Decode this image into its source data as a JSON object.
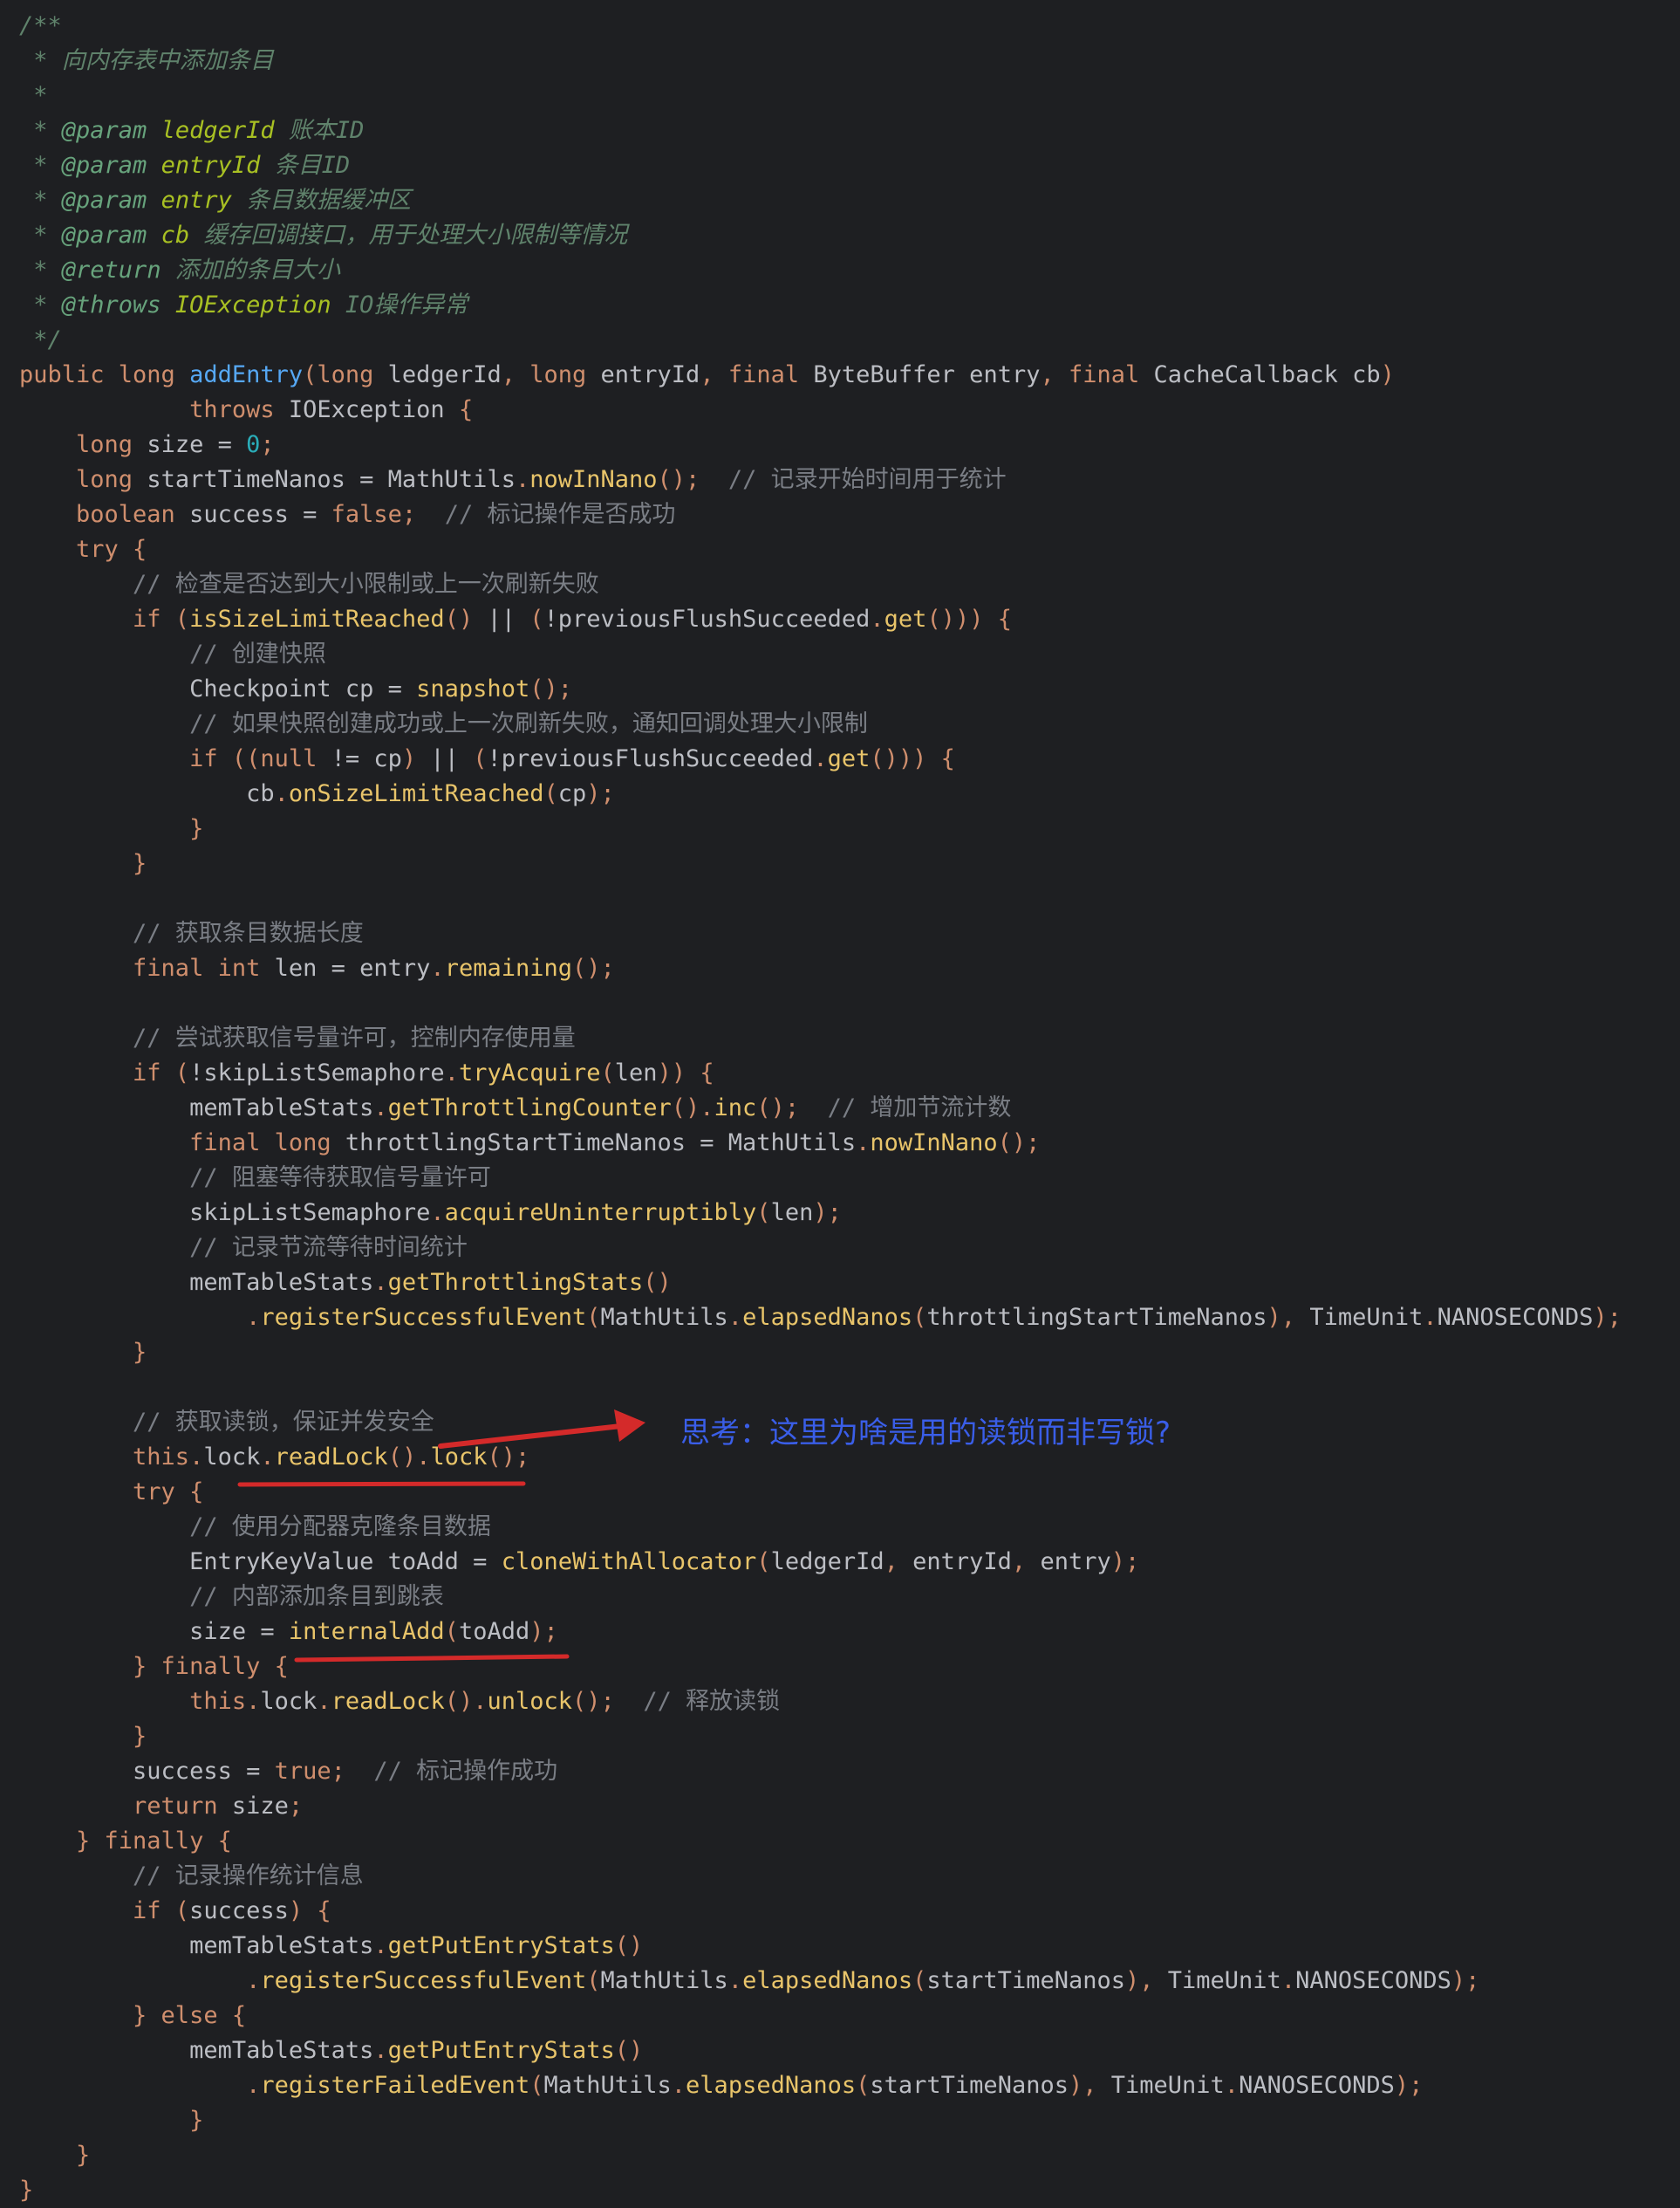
{
  "code_lines": [
    [
      {
        "t": "/**",
        "c": "doc"
      }
    ],
    [
      {
        "t": " * 向内存表中添加条目",
        "c": "doc"
      }
    ],
    [
      {
        "t": " *",
        "c": "doc"
      }
    ],
    [
      {
        "t": " * ",
        "c": "doc"
      },
      {
        "t": "@param",
        "c": "doctag"
      },
      {
        "t": " ledgerId",
        "c": "docparam"
      },
      {
        "t": " 账本ID",
        "c": "doc"
      }
    ],
    [
      {
        "t": " * ",
        "c": "doc"
      },
      {
        "t": "@param",
        "c": "doctag"
      },
      {
        "t": " entryId",
        "c": "docparam"
      },
      {
        "t": " 条目ID",
        "c": "doc"
      }
    ],
    [
      {
        "t": " * ",
        "c": "doc"
      },
      {
        "t": "@param",
        "c": "doctag"
      },
      {
        "t": " entry",
        "c": "docparam"
      },
      {
        "t": " 条目数据缓冲区",
        "c": "doc"
      }
    ],
    [
      {
        "t": " * ",
        "c": "doc"
      },
      {
        "t": "@param",
        "c": "doctag"
      },
      {
        "t": " cb",
        "c": "docparam"
      },
      {
        "t": " 缓存回调接口，用于处理大小限制等情况",
        "c": "doc"
      }
    ],
    [
      {
        "t": " * ",
        "c": "doc"
      },
      {
        "t": "@return",
        "c": "doctag"
      },
      {
        "t": " 添加的条目大小",
        "c": "doc"
      }
    ],
    [
      {
        "t": " * ",
        "c": "doc"
      },
      {
        "t": "@throws",
        "c": "doctag"
      },
      {
        "t": " IOException",
        "c": "docparam"
      },
      {
        "t": " IO操作异常",
        "c": "doc"
      }
    ],
    [
      {
        "t": " */",
        "c": "doc"
      }
    ],
    [
      {
        "t": "public long ",
        "c": "kw"
      },
      {
        "t": "addEntry",
        "c": "fn"
      },
      {
        "t": "(",
        "c": "kw"
      },
      {
        "t": "long ",
        "c": "kw"
      },
      {
        "t": "ledgerId",
        "c": "punct"
      },
      {
        "t": ", ",
        "c": "kw"
      },
      {
        "t": "long ",
        "c": "kw"
      },
      {
        "t": "entryId",
        "c": "punct"
      },
      {
        "t": ", ",
        "c": "kw"
      },
      {
        "t": "final ",
        "c": "kw"
      },
      {
        "t": "ByteBuffer entry",
        "c": "punct"
      },
      {
        "t": ", ",
        "c": "kw"
      },
      {
        "t": "final ",
        "c": "kw"
      },
      {
        "t": "CacheCallback cb",
        "c": "punct"
      },
      {
        "t": ")",
        "c": "kw"
      }
    ],
    [
      {
        "t": "            throws ",
        "c": "kw"
      },
      {
        "t": "IOException ",
        "c": "punct"
      },
      {
        "t": "{",
        "c": "kw"
      }
    ],
    [
      {
        "t": "    long ",
        "c": "kw"
      },
      {
        "t": "size = ",
        "c": "punct"
      },
      {
        "t": "0",
        "c": "num"
      },
      {
        "t": ";",
        "c": "kw"
      }
    ],
    [
      {
        "t": "    long ",
        "c": "kw"
      },
      {
        "t": "startTimeNanos = MathUtils",
        "c": "punct"
      },
      {
        "t": ".",
        "c": "kw"
      },
      {
        "t": "nowInNano",
        "c": "mc"
      },
      {
        "t": "();",
        "c": "kw"
      },
      {
        "t": "  // 记录开始时间用于统计",
        "c": "cm"
      }
    ],
    [
      {
        "t": "    boolean ",
        "c": "kw"
      },
      {
        "t": "success = ",
        "c": "punct"
      },
      {
        "t": "false;",
        "c": "kw"
      },
      {
        "t": "  // 标记操作是否成功",
        "c": "cm"
      }
    ],
    [
      {
        "t": "    try {",
        "c": "kw"
      }
    ],
    [
      {
        "t": "        // 检查是否达到大小限制或上一次刷新失败",
        "c": "cm"
      }
    ],
    [
      {
        "t": "        if (",
        "c": "kw"
      },
      {
        "t": "isSizeLimitReached",
        "c": "mc"
      },
      {
        "t": "() ",
        "c": "kw"
      },
      {
        "t": "|| ",
        "c": "punct"
      },
      {
        "t": "(",
        "c": "kw"
      },
      {
        "t": "!previousFlushSucceeded",
        "c": "punct"
      },
      {
        "t": ".",
        "c": "kw"
      },
      {
        "t": "get",
        "c": "mc"
      },
      {
        "t": "())) {",
        "c": "kw"
      }
    ],
    [
      {
        "t": "            // 创建快照",
        "c": "cm"
      }
    ],
    [
      {
        "t": "            Checkpoint cp = ",
        "c": "punct"
      },
      {
        "t": "snapshot",
        "c": "mc"
      },
      {
        "t": "();",
        "c": "kw"
      }
    ],
    [
      {
        "t": "            // 如果快照创建成功或上一次刷新失败，通知回调处理大小限制",
        "c": "cm"
      }
    ],
    [
      {
        "t": "            if ((null ",
        "c": "kw"
      },
      {
        "t": "!= cp",
        "c": "punct"
      },
      {
        "t": ") ",
        "c": "kw"
      },
      {
        "t": "|| ",
        "c": "punct"
      },
      {
        "t": "(",
        "c": "kw"
      },
      {
        "t": "!previousFlushSucceeded",
        "c": "punct"
      },
      {
        "t": ".",
        "c": "kw"
      },
      {
        "t": "get",
        "c": "mc"
      },
      {
        "t": "())) {",
        "c": "kw"
      }
    ],
    [
      {
        "t": "                cb",
        "c": "punct"
      },
      {
        "t": ".",
        "c": "kw"
      },
      {
        "t": "onSizeLimitReached",
        "c": "mc"
      },
      {
        "t": "(",
        "c": "kw"
      },
      {
        "t": "cp",
        "c": "punct"
      },
      {
        "t": ");",
        "c": "kw"
      }
    ],
    [
      {
        "t": "            }",
        "c": "kw"
      }
    ],
    [
      {
        "t": "        }",
        "c": "kw"
      }
    ],
    [],
    [
      {
        "t": "        // 获取条目数据长度",
        "c": "cm"
      }
    ],
    [
      {
        "t": "        final int ",
        "c": "kw"
      },
      {
        "t": "len = entry",
        "c": "punct"
      },
      {
        "t": ".",
        "c": "kw"
      },
      {
        "t": "remaining",
        "c": "mc"
      },
      {
        "t": "();",
        "c": "kw"
      }
    ],
    [],
    [
      {
        "t": "        // 尝试获取信号量许可，控制内存使用量",
        "c": "cm"
      }
    ],
    [
      {
        "t": "        if (",
        "c": "kw"
      },
      {
        "t": "!skipListSemaphore",
        "c": "punct"
      },
      {
        "t": ".",
        "c": "kw"
      },
      {
        "t": "tryAcquire",
        "c": "mc"
      },
      {
        "t": "(",
        "c": "kw"
      },
      {
        "t": "len",
        "c": "punct"
      },
      {
        "t": ")) {",
        "c": "kw"
      }
    ],
    [
      {
        "t": "            memTableStats",
        "c": "punct"
      },
      {
        "t": ".",
        "c": "kw"
      },
      {
        "t": "getThrottlingCounter",
        "c": "mc"
      },
      {
        "t": "().",
        "c": "kw"
      },
      {
        "t": "inc",
        "c": "mc"
      },
      {
        "t": "();",
        "c": "kw"
      },
      {
        "t": "  // 增加节流计数",
        "c": "cm"
      }
    ],
    [
      {
        "t": "            final long ",
        "c": "kw"
      },
      {
        "t": "throttlingStartTimeNanos = MathUtils",
        "c": "punct"
      },
      {
        "t": ".",
        "c": "kw"
      },
      {
        "t": "nowInNano",
        "c": "mc"
      },
      {
        "t": "();",
        "c": "kw"
      }
    ],
    [
      {
        "t": "            // 阻塞等待获取信号量许可",
        "c": "cm"
      }
    ],
    [
      {
        "t": "            skipListSemaphore",
        "c": "punct"
      },
      {
        "t": ".",
        "c": "kw"
      },
      {
        "t": "acquireUninterruptibly",
        "c": "mc"
      },
      {
        "t": "(",
        "c": "kw"
      },
      {
        "t": "len",
        "c": "punct"
      },
      {
        "t": ");",
        "c": "kw"
      }
    ],
    [
      {
        "t": "            // 记录节流等待时间统计",
        "c": "cm"
      }
    ],
    [
      {
        "t": "            memTableStats",
        "c": "punct"
      },
      {
        "t": ".",
        "c": "kw"
      },
      {
        "t": "getThrottlingStats",
        "c": "mc"
      },
      {
        "t": "()",
        "c": "kw"
      }
    ],
    [
      {
        "t": "                .",
        "c": "kw"
      },
      {
        "t": "registerSuccessfulEvent",
        "c": "mc"
      },
      {
        "t": "(",
        "c": "kw"
      },
      {
        "t": "MathUtils",
        "c": "punct"
      },
      {
        "t": ".",
        "c": "kw"
      },
      {
        "t": "elapsedNanos",
        "c": "mc"
      },
      {
        "t": "(",
        "c": "kw"
      },
      {
        "t": "throttlingStartTimeNanos",
        "c": "punct"
      },
      {
        "t": "), ",
        "c": "kw"
      },
      {
        "t": "TimeUnit",
        "c": "punct"
      },
      {
        "t": ".",
        "c": "kw"
      },
      {
        "t": "NANOSECONDS",
        "c": "punct"
      },
      {
        "t": ");",
        "c": "kw"
      }
    ],
    [
      {
        "t": "        }",
        "c": "kw"
      }
    ],
    [],
    [
      {
        "t": "        // 获取读锁，保证并发安全",
        "c": "cm"
      }
    ],
    [
      {
        "t": "        this",
        "c": "kw"
      },
      {
        "t": ".",
        "c": "kw"
      },
      {
        "t": "lock",
        "c": "punct"
      },
      {
        "t": ".",
        "c": "kw"
      },
      {
        "t": "readLock",
        "c": "mc"
      },
      {
        "t": "().",
        "c": "kw"
      },
      {
        "t": "lock",
        "c": "mc"
      },
      {
        "t": "();",
        "c": "kw"
      }
    ],
    [
      {
        "t": "        try {",
        "c": "kw"
      }
    ],
    [
      {
        "t": "            // 使用分配器克隆条目数据",
        "c": "cm"
      }
    ],
    [
      {
        "t": "            EntryKeyValue toAdd = ",
        "c": "punct"
      },
      {
        "t": "cloneWithAllocator",
        "c": "mc"
      },
      {
        "t": "(",
        "c": "kw"
      },
      {
        "t": "ledgerId",
        "c": "punct"
      },
      {
        "t": ", ",
        "c": "kw"
      },
      {
        "t": "entryId",
        "c": "punct"
      },
      {
        "t": ", ",
        "c": "kw"
      },
      {
        "t": "entry",
        "c": "punct"
      },
      {
        "t": ");",
        "c": "kw"
      }
    ],
    [
      {
        "t": "            // 内部添加条目到跳表",
        "c": "cm"
      }
    ],
    [
      {
        "t": "            size = ",
        "c": "punct"
      },
      {
        "t": "internalAdd",
        "c": "mc"
      },
      {
        "t": "(",
        "c": "kw"
      },
      {
        "t": "toAdd",
        "c": "punct"
      },
      {
        "t": ");",
        "c": "kw"
      }
    ],
    [
      {
        "t": "        } finally {",
        "c": "kw"
      }
    ],
    [
      {
        "t": "            this",
        "c": "kw"
      },
      {
        "t": ".",
        "c": "kw"
      },
      {
        "t": "lock",
        "c": "punct"
      },
      {
        "t": ".",
        "c": "kw"
      },
      {
        "t": "readLock",
        "c": "mc"
      },
      {
        "t": "().",
        "c": "kw"
      },
      {
        "t": "unlock",
        "c": "mc"
      },
      {
        "t": "();",
        "c": "kw"
      },
      {
        "t": "  // 释放读锁",
        "c": "cm"
      }
    ],
    [
      {
        "t": "        }",
        "c": "kw"
      }
    ],
    [
      {
        "t": "        success = ",
        "c": "punct"
      },
      {
        "t": "true;",
        "c": "kw"
      },
      {
        "t": "  // 标记操作成功",
        "c": "cm"
      }
    ],
    [
      {
        "t": "        return ",
        "c": "kw"
      },
      {
        "t": "size",
        "c": "punct"
      },
      {
        "t": ";",
        "c": "kw"
      }
    ],
    [
      {
        "t": "    } finally {",
        "c": "kw"
      }
    ],
    [
      {
        "t": "        // 记录操作统计信息",
        "c": "cm"
      }
    ],
    [
      {
        "t": "        if (",
        "c": "kw"
      },
      {
        "t": "success",
        "c": "punct"
      },
      {
        "t": ") {",
        "c": "kw"
      }
    ],
    [
      {
        "t": "            memTableStats",
        "c": "punct"
      },
      {
        "t": ".",
        "c": "kw"
      },
      {
        "t": "getPutEntryStats",
        "c": "mc"
      },
      {
        "t": "()",
        "c": "kw"
      }
    ],
    [
      {
        "t": "                .",
        "c": "kw"
      },
      {
        "t": "registerSuccessfulEvent",
        "c": "mc"
      },
      {
        "t": "(",
        "c": "kw"
      },
      {
        "t": "MathUtils",
        "c": "punct"
      },
      {
        "t": ".",
        "c": "kw"
      },
      {
        "t": "elapsedNanos",
        "c": "mc"
      },
      {
        "t": "(",
        "c": "kw"
      },
      {
        "t": "startTimeNanos",
        "c": "punct"
      },
      {
        "t": "), ",
        "c": "kw"
      },
      {
        "t": "TimeUnit",
        "c": "punct"
      },
      {
        "t": ".",
        "c": "kw"
      },
      {
        "t": "NANOSECONDS",
        "c": "punct"
      },
      {
        "t": ");",
        "c": "kw"
      }
    ],
    [
      {
        "t": "        } else {",
        "c": "kw"
      }
    ],
    [
      {
        "t": "            memTableStats",
        "c": "punct"
      },
      {
        "t": ".",
        "c": "kw"
      },
      {
        "t": "getPutEntryStats",
        "c": "mc"
      },
      {
        "t": "()",
        "c": "kw"
      }
    ],
    [
      {
        "t": "                .",
        "c": "kw"
      },
      {
        "t": "registerFailedEvent",
        "c": "mc"
      },
      {
        "t": "(",
        "c": "kw"
      },
      {
        "t": "MathUtils",
        "c": "punct"
      },
      {
        "t": ".",
        "c": "kw"
      },
      {
        "t": "elapsedNanos",
        "c": "mc"
      },
      {
        "t": "(",
        "c": "kw"
      },
      {
        "t": "startTimeNanos",
        "c": "punct"
      },
      {
        "t": "), ",
        "c": "kw"
      },
      {
        "t": "TimeUnit",
        "c": "punct"
      },
      {
        "t": ".",
        "c": "kw"
      },
      {
        "t": "NANOSECONDS",
        "c": "punct"
      },
      {
        "t": ");",
        "c": "kw"
      }
    ],
    [
      {
        "t": "            }",
        "c": "kw"
      }
    ],
    [
      {
        "t": "    }",
        "c": "kw"
      }
    ],
    [
      {
        "t": "}",
        "c": "kw"
      }
    ]
  ],
  "annotation": {
    "note_text": "思考：这里为啥是用的读锁而非写锁?",
    "note_color": "#3a5ee8",
    "mark_color": "#d42a2a"
  },
  "theme": {
    "background": "#1e1f22",
    "keyword": "#cf8e6d",
    "method": "#e8c46a",
    "comment": "#7a7e85",
    "number": "#2aacb8",
    "default_text": "#bcbec4"
  }
}
